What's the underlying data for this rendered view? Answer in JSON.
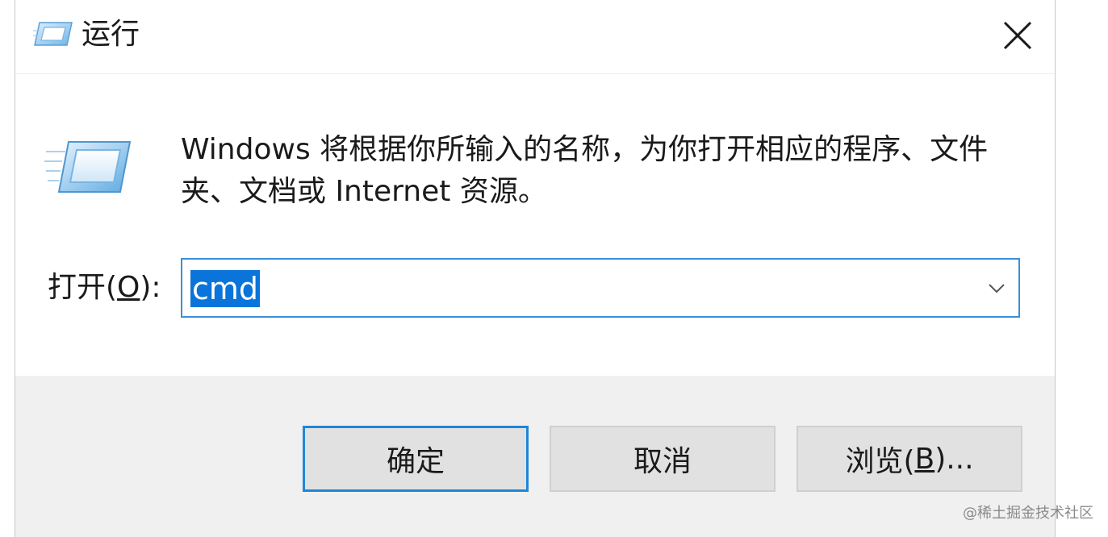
{
  "window": {
    "title": "运行",
    "icon": "run-icon"
  },
  "description": "Windows 将根据你所输入的名称，为你打开相应的程序、文件夹、文档或 Internet 资源。",
  "open": {
    "label_prefix": "打开(",
    "label_access": "O",
    "label_suffix": "):",
    "value": "cmd"
  },
  "buttons": {
    "ok": "确定",
    "cancel": "取消",
    "browse_prefix": "浏览(",
    "browse_access": "B",
    "browse_suffix": ")..."
  },
  "watermark": "@稀土掘金技术社区",
  "colors": {
    "accent": "#0a74da",
    "focus_border": "#3c8fd8",
    "footer_bg": "#f0f0f0"
  }
}
